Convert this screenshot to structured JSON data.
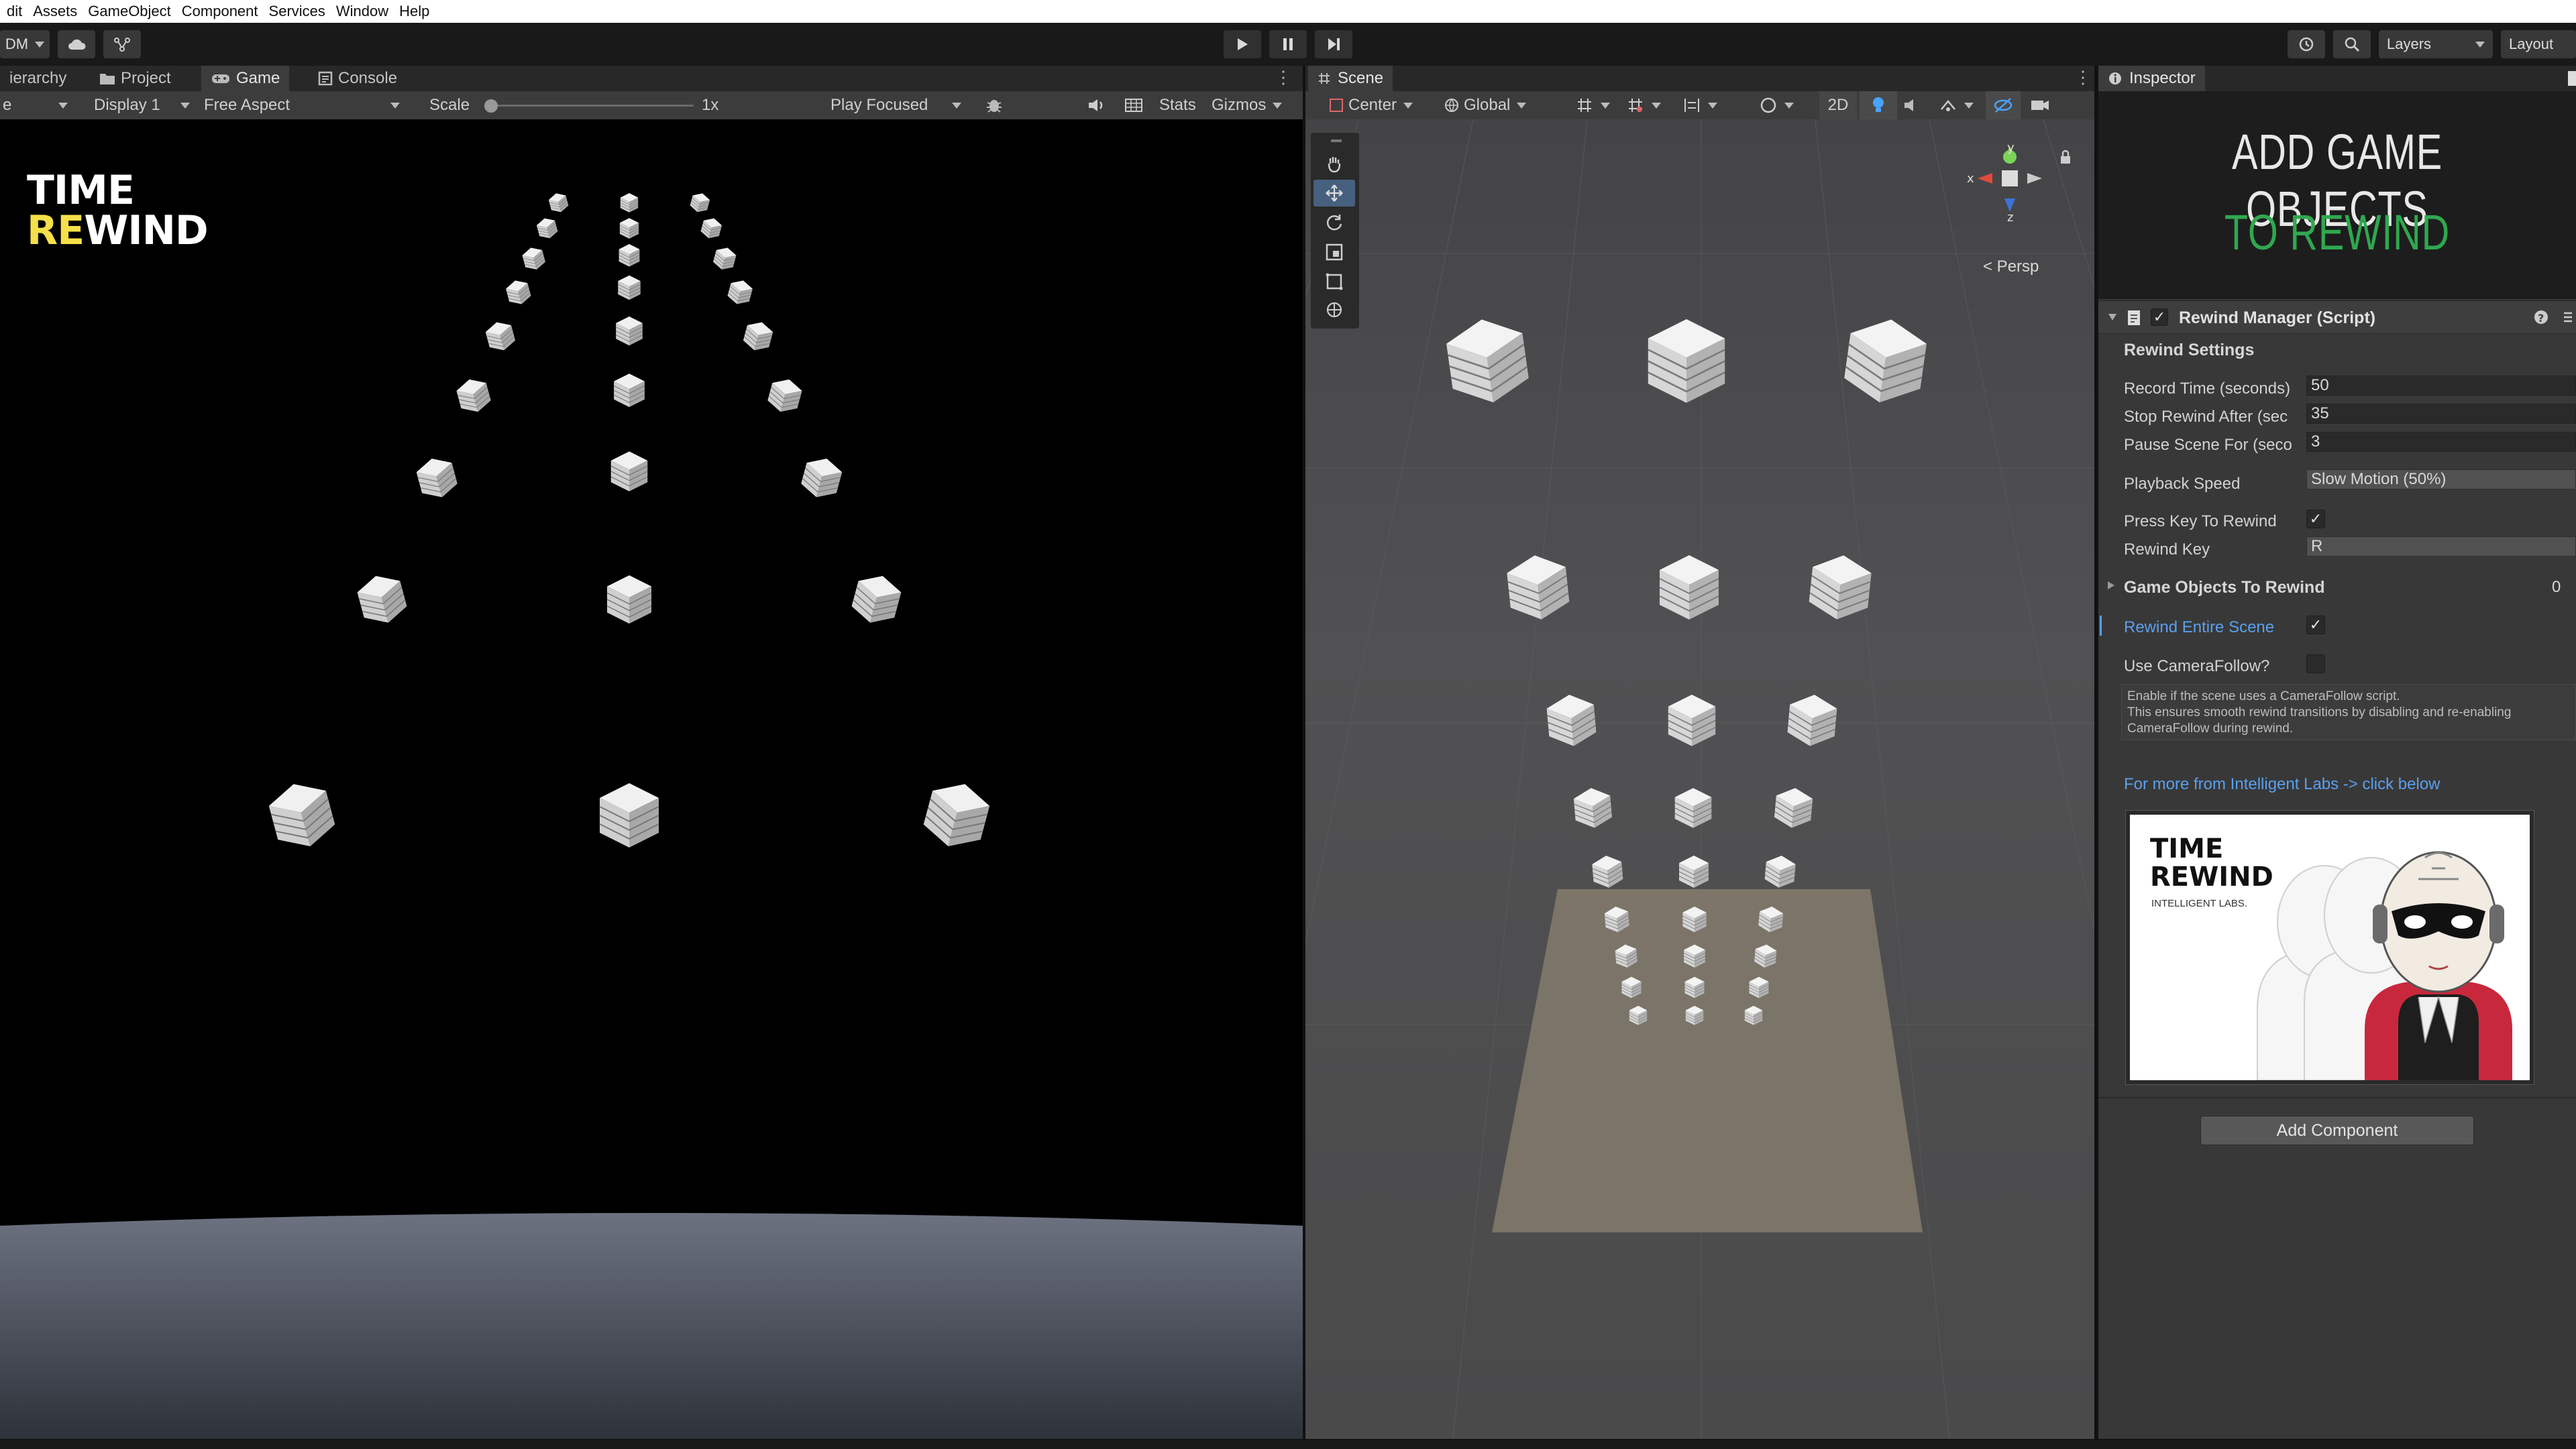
{
  "menu": [
    "dit",
    "Assets",
    "GameObject",
    "Component",
    "Services",
    "Window",
    "Help"
  ],
  "toolbar": {
    "account": "DM",
    "play_icon": "play-icon",
    "pause_icon": "pause-icon",
    "step_icon": "step-icon",
    "layers": "Layers",
    "layout": "Layout"
  },
  "game_tabs": {
    "hierarchy": "ierarchy",
    "project": "Project",
    "game": "Game",
    "console": "Console"
  },
  "game_bar": {
    "game_select": "e",
    "display": "Display 1",
    "aspect": "Free Aspect",
    "scale_label": "Scale",
    "scale_value": "1x",
    "scale_fraction": 0.0,
    "play_mode": "Play Focused",
    "stats": "Stats",
    "gizmos": "Gizmos"
  },
  "game_view": {
    "logo_line1": "TIME",
    "logo_line2_highlight": "RE",
    "logo_line2_rest": "WIND",
    "accent": "#f5e04a"
  },
  "scene": {
    "tab": "Scene",
    "pivot": "Center",
    "space": "Global",
    "mode_2d": "2D",
    "persp": "< Persp",
    "axis_y": "y",
    "axis_x": "x",
    "axis_z": "z"
  },
  "inspector": {
    "tab": "Inspector",
    "banner_line1": "ADD GAME OBJECTS",
    "banner_line2": "TO REWIND",
    "banner_accent": "#2fa84f",
    "component_title": "Rewind Manager (Script)",
    "section": "Rewind Settings",
    "fields": {
      "record_time_label": "Record Time (seconds)",
      "record_time_value": "50",
      "stop_rewind_label": "Stop Rewind After (sec",
      "stop_rewind_value": "35",
      "pause_scene_label": "Pause Scene For (seco",
      "pause_scene_value": "3",
      "playback_label": "Playback Speed",
      "playback_value": "Slow Motion (50%)",
      "press_key_label": "Press Key To Rewind",
      "press_key_checked": true,
      "rewind_key_label": "Rewind Key",
      "rewind_key_value": "R",
      "game_objects_label": "Game Objects To Rewind",
      "game_objects_count": "0",
      "entire_scene_label": "Rewind Entire Scene",
      "entire_scene_checked": true,
      "camera_follow_label": "Use CameraFollow?",
      "camera_follow_checked": false
    },
    "help_text_1": "Enable if the scene uses a CameraFollow script.",
    "help_text_2": "This ensures smooth rewind transitions by disabling and re-enabling",
    "help_text_3": "CameraFollow during rewind.",
    "link": "For more from Intelligent Labs -> click below",
    "ad_title1": "TIME",
    "ad_title2": "REWIND",
    "ad_sub": "INTELLIGENT LABS.",
    "add_component": "Add Component"
  },
  "check_mark": "✓"
}
